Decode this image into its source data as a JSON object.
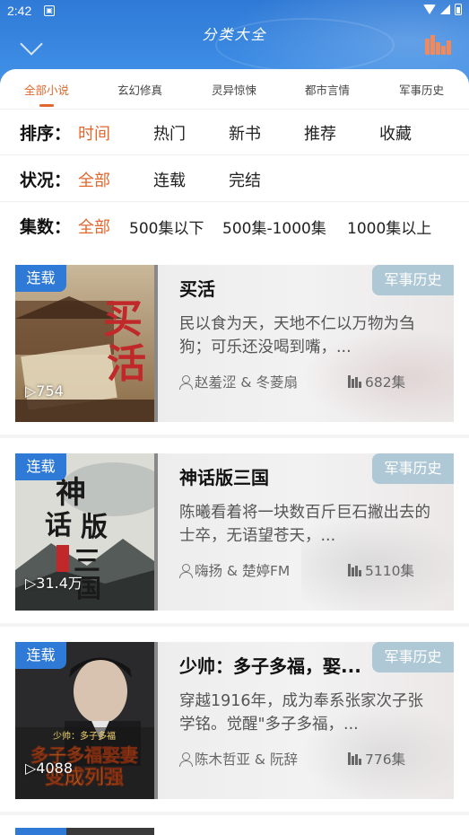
{
  "status_bar": {
    "time": "2:42",
    "app_icon": "notification-app-icon",
    "icons": [
      "wifi-icon",
      "signal-icon",
      "battery-icon"
    ]
  },
  "header": {
    "title": "分类大全",
    "left_icon": "chevron-down-icon",
    "right_icon": "bar-chart-icon"
  },
  "colors": {
    "header_blue": "#2f7ad6",
    "accent_orange": "#e0672d",
    "tag_blue": "#2f7ad6",
    "genre_tag": "#aec8d6"
  },
  "category_tabs": [
    {
      "label": "全部小说",
      "active": true
    },
    {
      "label": "玄幻修真",
      "active": false
    },
    {
      "label": "灵异惊悚",
      "active": false
    },
    {
      "label": "都市言情",
      "active": false
    },
    {
      "label": "军事历史",
      "active": false
    }
  ],
  "filters": {
    "sort": {
      "label": "排序：",
      "options": [
        "时间",
        "热门",
        "新书",
        "推荐",
        "收藏"
      ],
      "selected": "时间"
    },
    "status": {
      "label": "状况：",
      "options": [
        "全部",
        "连载",
        "完结"
      ],
      "selected": "全部"
    },
    "episodes": {
      "label": "集数：",
      "options": [
        "全部",
        "500集以下",
        "500集-1000集",
        "1000集以上"
      ],
      "selected": "全部"
    }
  },
  "books": [
    {
      "status": "连载",
      "plays": "▷754",
      "title": "买活",
      "genre": "军事历史",
      "synopsis": "民以食为天，天地不仁以万物为刍狗；可乐还没喝到嘴，...",
      "authors": "赵羞涩 & 冬菱扇",
      "episodes": "682集",
      "cover_text": "买活"
    },
    {
      "status": "连载",
      "plays": "▷31.4万",
      "title": "神话版三国",
      "genre": "军事历史",
      "synopsis": "陈曦看着将一块数百斤巨石撇出去的士卒，无语望苍天，...",
      "authors": "嗨扬 & 楚婷FM",
      "episodes": "5110集",
      "cover_text": "神话版三国"
    },
    {
      "status": "连载",
      "plays": "▷4088",
      "title": "少帅：多子多福，娶...",
      "genre": "军事历史",
      "synopsis": "穿越1916年，成为奉系张家次子张学铭。觉醒\"多子多福，...",
      "authors": "陈木哲亚 & 阮辞",
      "episodes": "776集",
      "cover_text": "多子多福娶妻变成列强"
    }
  ]
}
